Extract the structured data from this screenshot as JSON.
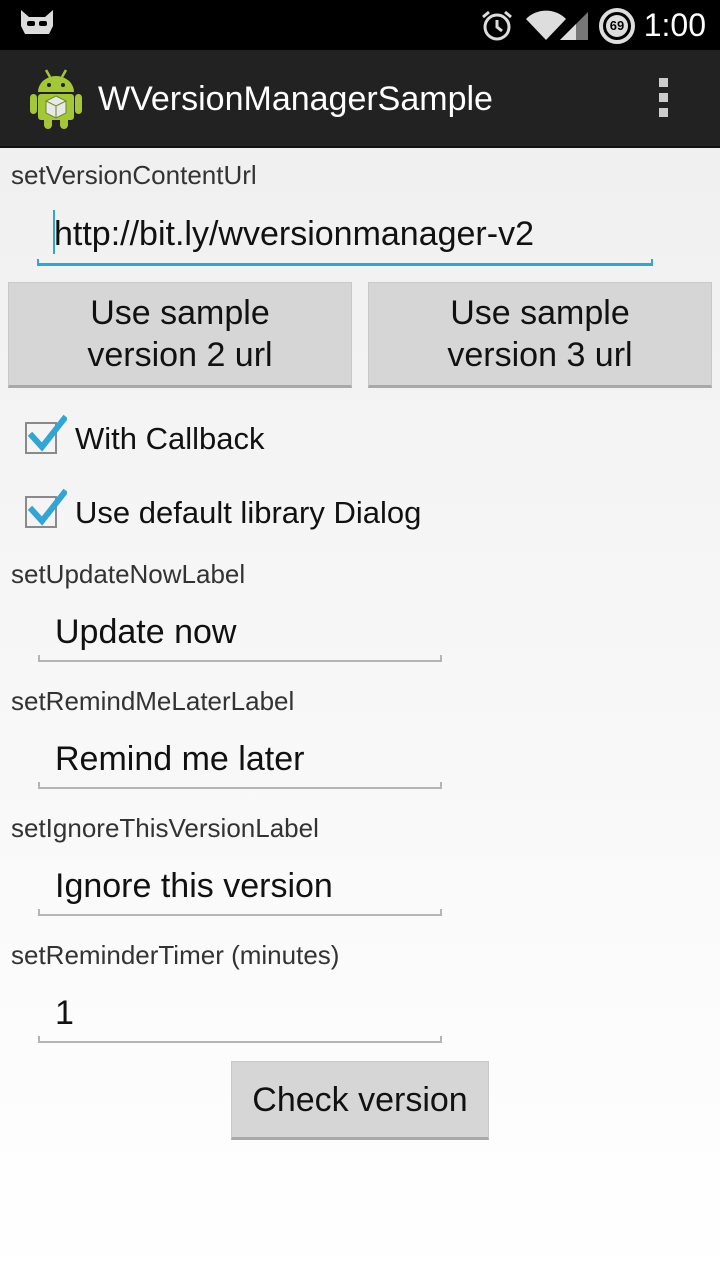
{
  "status_bar": {
    "time": "1:00",
    "battery_level": "69",
    "icons": [
      "cyanogen-mascot-icon",
      "alarm-icon",
      "wifi-icon",
      "cell-signal-icon",
      "battery-icon"
    ]
  },
  "action_bar": {
    "title": "WVersionManagerSample",
    "icons": [
      "app-android-icon",
      "overflow-menu-icon"
    ]
  },
  "form": {
    "version_url_label": "setVersionContentUrl",
    "version_url_value": "http://bit.ly/wversionmanager-v2",
    "sample_v2_button": "Use sample version 2 url",
    "sample_v3_button": "Use sample version 3 url",
    "with_callback_label": "With Callback",
    "with_callback_checked": true,
    "default_dialog_label": "Use default library Dialog",
    "default_dialog_checked": true,
    "update_now_label": "setUpdateNowLabel",
    "update_now_value": "Update now",
    "remind_later_label": "setRemindMeLaterLabel",
    "remind_later_value": "Remind me later",
    "ignore_version_label": "setIgnoreThisVersionLabel",
    "ignore_version_value": "Ignore this version",
    "reminder_timer_label": "setReminderTimer (minutes)",
    "reminder_timer_value": "1",
    "check_version_button": "Check version"
  },
  "colors": {
    "accent": "#33a5d2",
    "action_bar": "#222222",
    "android_green": "#a4c639"
  }
}
